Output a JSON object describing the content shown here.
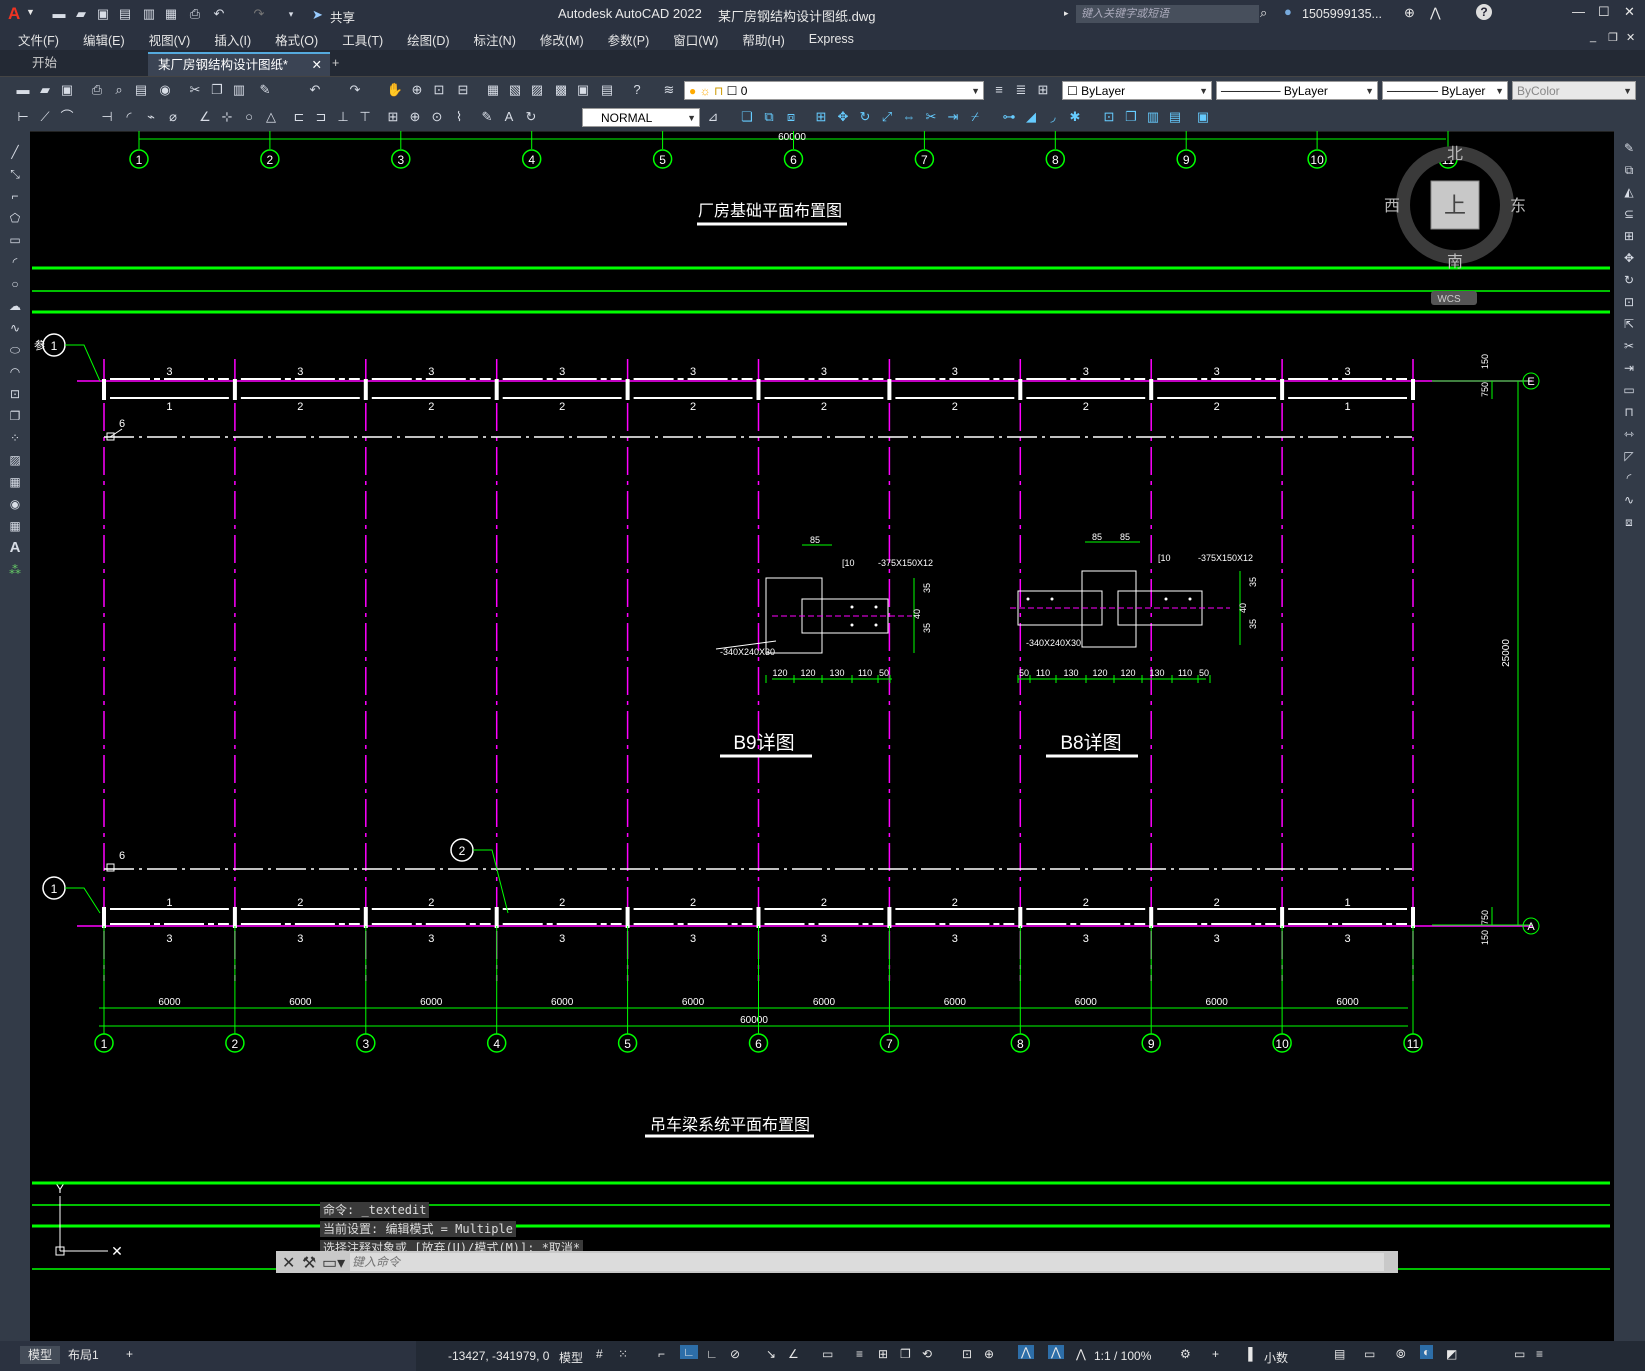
{
  "app": {
    "title": "Autodesk AutoCAD 2022",
    "filename": "某厂房钢结构设计图纸.dwg",
    "search_placeholder": "键入关键字或短语",
    "user": "1505999135...",
    "share": "共享"
  },
  "menu": [
    "文件(F)",
    "编辑(E)",
    "视图(V)",
    "插入(I)",
    "格式(O)",
    "工具(T)",
    "绘图(D)",
    "标注(N)",
    "修改(M)",
    "参数(P)",
    "窗口(W)",
    "帮助(H)",
    "Express"
  ],
  "tabs": {
    "start": "开始",
    "active": "某厂房钢结构设计图纸*"
  },
  "toolbar": {
    "layer_value": "0",
    "color": "ByLayer",
    "linetype": "ByLayer",
    "lineweight": "ByLayer",
    "plotstyle": "ByColor",
    "textstyle": "NORMAL"
  },
  "viewcube": {
    "north": "北",
    "south": "南",
    "east": "东",
    "west": "西",
    "top": "上",
    "wcs": "WCS"
  },
  "drawing": {
    "title_top": "厂房基础平面布置图",
    "title_bottom": "吊车梁系统平面布置图",
    "detail_b9": "B9详图",
    "detail_b8": "B8详图",
    "top_dim": "60000",
    "overall_dim": "60000",
    "height_dim": "25000",
    "dim_750": "750",
    "dim_150": "150",
    "axis_labels": [
      "1",
      "2",
      "3",
      "4",
      "5",
      "6",
      "7",
      "8",
      "9",
      "10",
      "11"
    ],
    "row_labels": {
      "top": "E",
      "bottom": "A"
    },
    "span_dim": "6000",
    "beam_num_top_row": [
      "3",
      "3",
      "3",
      "3",
      "3",
      "3",
      "3",
      "3",
      "3",
      "3"
    ],
    "beam_num_top_under": [
      "1",
      "2",
      "2",
      "2",
      "2",
      "2",
      "2",
      "2",
      "2",
      "1"
    ],
    "beam_num_bottom_over": [
      "1",
      "2",
      "2",
      "2",
      "2",
      "2",
      "2",
      "2",
      "2",
      "1"
    ],
    "beam_num_bottom_under": [
      "3",
      "3",
      "3",
      "3",
      "3",
      "3",
      "3",
      "3",
      "3",
      "3"
    ],
    "ref_label": "参",
    "callout_6": "6",
    "b9_dims": [
      "120",
      "120",
      "130",
      "110",
      "50"
    ],
    "b8_dims": [
      "50",
      "110",
      "130",
      "120",
      "120",
      "130",
      "110",
      "50"
    ],
    "b9_labels": {
      "c10": "[10",
      "plate1": "-375X150X12",
      "plate2": "-340X240X30",
      "top": "85",
      "side": [
        "35",
        "40",
        "35"
      ]
    },
    "b8_labels": {
      "c10": "[10",
      "plate1": "-375X150X12",
      "plate2": "-340X240X30",
      "top": [
        "85",
        "85"
      ],
      "side": [
        "35",
        "40",
        "35"
      ]
    }
  },
  "command": {
    "line1": "命令: _textedit",
    "line2": "当前设置: 编辑模式 = Multiple",
    "line3": "选择注释对象或 [放弃(U)/模式(M)]: *取消*",
    "placeholder": "键入命令"
  },
  "status": {
    "tab_model": "模型",
    "tab_layout": "布局1",
    "coords": "-13427, -341979, 0",
    "space": "模型",
    "scale": "1:1 / 100%",
    "units": "小数"
  },
  "colors": {
    "green": "#00ff00",
    "magenta": "#ff00ff",
    "white": "#ffffff",
    "ui_bg": "#2b3240",
    "toolbar_bg": "#333b48"
  }
}
